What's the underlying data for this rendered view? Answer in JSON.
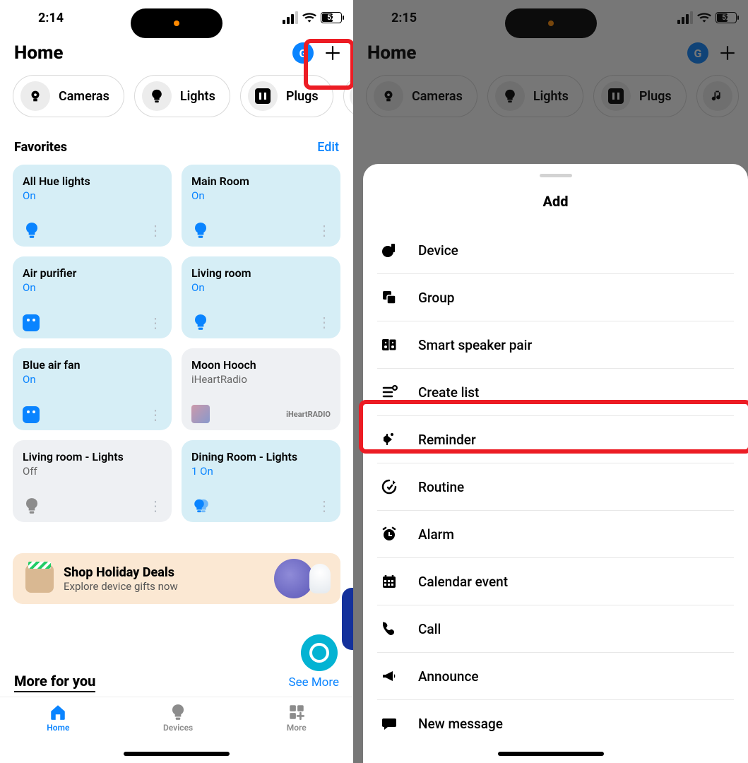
{
  "left": {
    "status": {
      "time": "2:14",
      "battery": "52"
    },
    "header": {
      "title": "Home",
      "avatar": "G"
    },
    "chips": [
      {
        "label": "Cameras",
        "icon": "camera"
      },
      {
        "label": "Lights",
        "icon": "bulb"
      },
      {
        "label": "Plugs",
        "icon": "plug"
      },
      {
        "label": "",
        "icon": "music"
      }
    ],
    "favorites": {
      "title": "Favorites",
      "edit": "Edit",
      "items": [
        {
          "name": "All Hue lights",
          "state": "On",
          "icon": "bulb",
          "variant": "blue"
        },
        {
          "name": "Main Room",
          "state": "On",
          "icon": "bulb",
          "variant": "blue"
        },
        {
          "name": "Air purifier",
          "state": "On",
          "icon": "switch",
          "variant": "blue"
        },
        {
          "name": "Living room",
          "state": "On",
          "icon": "bulb",
          "variant": "blue"
        },
        {
          "name": "Blue air fan",
          "state": "On",
          "icon": "switch",
          "variant": "blue"
        },
        {
          "name": "Moon Hooch",
          "state": "iHeartRadio",
          "icon": "album",
          "variant": "gray",
          "brand": "iHeartRADIO"
        },
        {
          "name": "Living room - Lights",
          "state": "Off",
          "icon": "bulb-off",
          "variant": "gray"
        },
        {
          "name": "Dining Room - Lights",
          "state": "1 On",
          "icon": "bulb-multi",
          "variant": "blue"
        }
      ]
    },
    "promo": {
      "title": "Shop Holiday Deals",
      "subtitle": "Explore device gifts now"
    },
    "more": {
      "title": "More for you",
      "link": "See More"
    },
    "tabs": [
      {
        "label": "Home"
      },
      {
        "label": "Devices"
      },
      {
        "label": "More"
      }
    ]
  },
  "right": {
    "status": {
      "time": "2:15",
      "battery": "52"
    },
    "header": {
      "title": "Home",
      "avatar": "G"
    },
    "chips": [
      {
        "label": "Cameras"
      },
      {
        "label": "Lights"
      },
      {
        "label": "Plugs"
      }
    ],
    "sheet": {
      "title": "Add",
      "items": [
        {
          "label": "Device",
          "icon": "device"
        },
        {
          "label": "Group",
          "icon": "group"
        },
        {
          "label": "Smart speaker pair",
          "icon": "speaker-pair"
        },
        {
          "label": "Create list",
          "icon": "list"
        },
        {
          "label": "Reminder",
          "icon": "reminder"
        },
        {
          "label": "Routine",
          "icon": "routine"
        },
        {
          "label": "Alarm",
          "icon": "alarm"
        },
        {
          "label": "Calendar event",
          "icon": "calendar"
        },
        {
          "label": "Call",
          "icon": "call"
        },
        {
          "label": "Announce",
          "icon": "announce"
        },
        {
          "label": "New message",
          "icon": "message"
        }
      ]
    }
  }
}
